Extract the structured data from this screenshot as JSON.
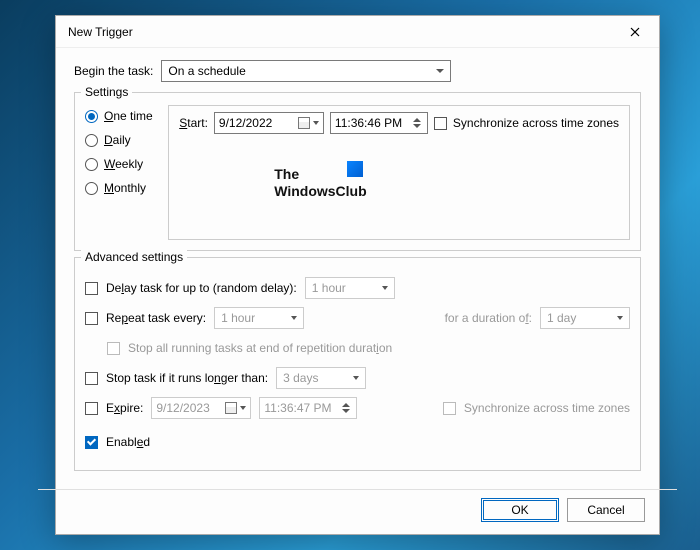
{
  "title": "New Trigger",
  "begin_label": "Begin the task:",
  "begin_value": "On a schedule",
  "settings_legend": "Settings",
  "recurrence": {
    "one_time": "One time",
    "daily": "Daily",
    "weekly": "Weekly",
    "monthly": "Monthly"
  },
  "start": {
    "label": "Start:",
    "date": "9/12/2022",
    "time": "11:36:46 PM",
    "sync_label": "Synchronize across time zones"
  },
  "watermark_line1": "The",
  "watermark_line2": "WindowsClub",
  "advanced_legend": "Advanced settings",
  "adv": {
    "delay_label": "Delay task for up to (random delay):",
    "delay_value": "1 hour",
    "repeat_label": "Repeat task every:",
    "repeat_value": "1 hour",
    "duration_label": "for a duration of:",
    "duration_value": "1 day",
    "stop_all_label": "Stop all running tasks at end of repetition duration",
    "stop_longer_label": "Stop task if it runs longer than:",
    "stop_longer_value": "3 days",
    "expire_label": "Expire:",
    "expire_date": "9/12/2023",
    "expire_time": "11:36:47 PM",
    "expire_sync_label": "Synchronize across time zones",
    "enabled_label": "Enabled"
  },
  "buttons": {
    "ok": "OK",
    "cancel": "Cancel"
  }
}
